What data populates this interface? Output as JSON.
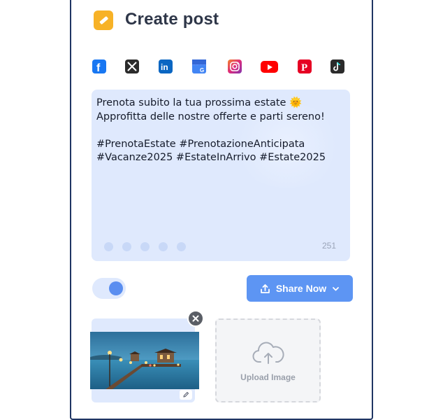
{
  "header": {
    "title": "Create post",
    "icon": "pencil-icon",
    "icon_color": "#f7b227"
  },
  "platforms": [
    {
      "name": "facebook-icon",
      "color": "#1877f2"
    },
    {
      "name": "x-icon",
      "color": "#2b2b2b"
    },
    {
      "name": "linkedin-icon",
      "color": "#0a66c2"
    },
    {
      "name": "google-business-icon",
      "color": "#4285f4"
    },
    {
      "name": "instagram-icon",
      "color": "#e1306c"
    },
    {
      "name": "youtube-icon",
      "color": "#ff0000"
    },
    {
      "name": "pinterest-icon",
      "color": "#e60023"
    },
    {
      "name": "tiktok-icon",
      "color": "#2b2b2b"
    }
  ],
  "post": {
    "text": "Prenota subito la tua prossima estate 🌞\nApprofitta delle nostre offerte e parti sereno!\n\n#PrenotaEstate #PrenotazioneAnticipata\n#Vacanze2025 #EstateInArrivo #Estate2025",
    "char_count": "251"
  },
  "actions": {
    "share_label": "Share Now",
    "share_color": "#5d95f3",
    "toggle_on": true
  },
  "media": {
    "upload_label": "Upload Image"
  }
}
